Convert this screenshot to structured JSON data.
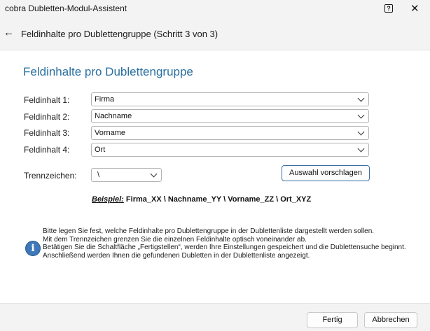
{
  "window": {
    "title": "cobra Dubletten-Modul-Assistent",
    "help_label": "?",
    "close_label": "✕"
  },
  "nav": {
    "back_icon": "arrow-left-icon",
    "title": "Feldinhalte pro Dublettengruppe (Schritt 3 von 3)"
  },
  "main": {
    "heading": "Feldinhalte pro Dublettengruppe",
    "fields": [
      {
        "label": "Feldinhalt 1:",
        "value": "Firma"
      },
      {
        "label": "Feldinhalt 2:",
        "value": "Nachname"
      },
      {
        "label": "Feldinhalt 3:",
        "value": "Vorname"
      },
      {
        "label": "Feldinhalt 4:",
        "value": "Ort"
      }
    ],
    "separator": {
      "label": "Trennzeichen:",
      "value": "\\"
    },
    "suggest_button": "Auswahl vorschlagen",
    "example": {
      "label": "Beispiel:",
      "text": " Firma_XX \\ Nachname_YY \\ Vorname_ZZ \\ Ort_XYZ"
    }
  },
  "info": {
    "icon": "info-icon",
    "lines": [
      "Bitte legen Sie fest, welche Feldinhalte pro Dublettengruppe in der Dublettenliste dargestellt werden sollen.",
      "Mit dem Trennzeichen grenzen Sie die einzelnen Feldinhalte optisch voneinander ab.",
      "Betätigen Sie die Schaltfläche „Fertigstellen“, werden Ihre Einstellungen gespeichert und die Dublettensuche beginnt.",
      "Anschließend werden Ihnen die gefundenen Dubletten in der Dublettenliste angezeigt."
    ]
  },
  "footer": {
    "finish_button": "Fertig",
    "cancel_button": "Abbrechen"
  },
  "colors": {
    "heading": "#2a6fa0",
    "accent_border": "#3b6fa6",
    "info_icon": "#3f78b8"
  }
}
